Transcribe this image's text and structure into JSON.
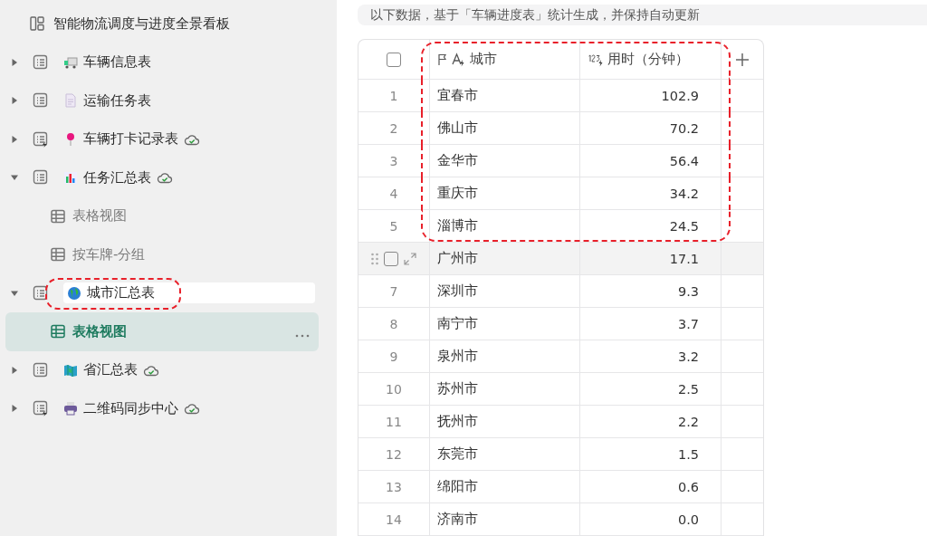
{
  "sidebar": {
    "items": [
      {
        "kind": "dashboard",
        "label": "智能物流调度与进度全景看板"
      },
      {
        "kind": "table",
        "label": "车辆信息表",
        "expanded": false,
        "synced": false
      },
      {
        "kind": "table",
        "label": "运输任务表",
        "expanded": false,
        "synced": false
      },
      {
        "kind": "automated-table",
        "label": "车辆打卡记录表",
        "expanded": false,
        "synced": true
      },
      {
        "kind": "table",
        "label": "任务汇总表",
        "expanded": true,
        "synced": true,
        "children": [
          {
            "label": "表格视图",
            "selected": false
          },
          {
            "label": "按车牌-分组",
            "selected": false
          }
        ]
      },
      {
        "kind": "table",
        "label": "城市汇总表",
        "expanded": true,
        "synced": false,
        "editing": true,
        "highlighted": true,
        "children": [
          {
            "label": "表格视图",
            "selected": true
          }
        ]
      },
      {
        "kind": "table",
        "label": "省汇总表",
        "expanded": false,
        "synced": true
      },
      {
        "kind": "automated-table",
        "label": "二维码同步中心",
        "expanded": false,
        "synced": true
      }
    ]
  },
  "notice": "以下数据，基于「车辆进度表」统计生成，并保持自动更新",
  "table": {
    "all_checked": false,
    "columns": [
      {
        "kind": "text",
        "label": "城市",
        "primary": true,
        "highlighted": true
      },
      {
        "kind": "number",
        "label": "用时（分钟）",
        "primary": false,
        "highlighted": true
      }
    ],
    "rows": [
      {
        "index": "1",
        "cells": [
          "宜春市",
          "102.9"
        ],
        "hovered": false,
        "highlighted": true
      },
      {
        "index": "2",
        "cells": [
          "佛山市",
          "70.2"
        ],
        "hovered": false,
        "highlighted": true
      },
      {
        "index": "3",
        "cells": [
          "金华市",
          "56.4"
        ],
        "hovered": false,
        "highlighted": true
      },
      {
        "index": "4",
        "cells": [
          "重庆市",
          "34.2"
        ],
        "hovered": false,
        "highlighted": true
      },
      {
        "index": "5",
        "cells": [
          "淄博市",
          "24.5"
        ],
        "hovered": false,
        "highlighted": true
      },
      {
        "cells": [
          "广州市",
          "17.1"
        ],
        "hovered": true,
        "checked": false,
        "highlighted": false
      },
      {
        "index": "7",
        "cells": [
          "深圳市",
          "9.3"
        ],
        "hovered": false,
        "highlighted": false
      },
      {
        "index": "8",
        "cells": [
          "南宁市",
          "3.7"
        ],
        "hovered": false,
        "highlighted": false
      },
      {
        "index": "9",
        "cells": [
          "泉州市",
          "3.2"
        ],
        "hovered": false,
        "highlighted": false
      },
      {
        "index": "10",
        "cells": [
          "苏州市",
          "2.5"
        ],
        "hovered": false,
        "highlighted": false
      },
      {
        "index": "11",
        "cells": [
          "抚州市",
          "2.2"
        ],
        "hovered": false,
        "highlighted": false
      },
      {
        "index": "12",
        "cells": [
          "东莞市",
          "1.5"
        ],
        "hovered": false,
        "highlighted": false
      },
      {
        "index": "13",
        "cells": [
          "绵阳市",
          "0.6"
        ],
        "hovered": false,
        "highlighted": false
      },
      {
        "index": "14",
        "cells": [
          "济南市",
          "0.0"
        ],
        "hovered": false,
        "highlighted": false
      }
    ]
  }
}
